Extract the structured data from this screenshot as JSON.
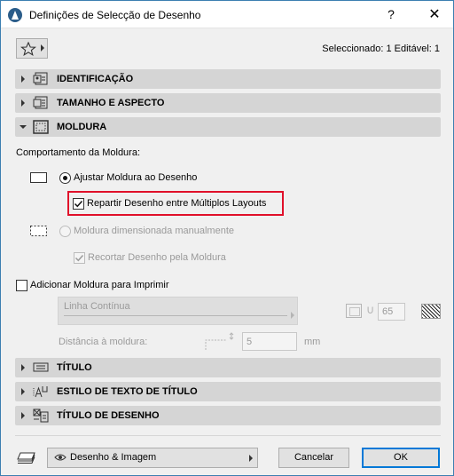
{
  "window": {
    "title": "Definições de Selecção de Desenho",
    "help_label": "?",
    "close_label": "✕"
  },
  "toolbar": {
    "favorites_icon": "star-icon",
    "selection_info": "Seleccionado: 1 Editável: 1"
  },
  "sections": [
    {
      "label": "IDENTIFICAÇÃO",
      "expanded": false,
      "icon": "id-card-icon"
    },
    {
      "label": "TAMANHO E ASPECTO",
      "expanded": false,
      "icon": "size-aspect-icon"
    },
    {
      "label": "MOLDURA",
      "expanded": true,
      "icon": "frame-icon"
    },
    {
      "label": "TÍTULO",
      "expanded": false,
      "icon": "title-icon"
    },
    {
      "label": "ESTILO DE TEXTO DE TÍTULO",
      "expanded": false,
      "icon": "title-text-style-icon"
    },
    {
      "label": "TÍTULO DE DESENHO",
      "expanded": false,
      "icon": "drawing-title-icon"
    }
  ],
  "frame": {
    "behavior_label": "Comportamento da Moldura:",
    "fit_frame_label": "Ajustar Moldura ao Desenho",
    "fit_frame_selected": true,
    "split_layouts_label": "Repartir Desenho entre Múltiplos Layouts",
    "split_layouts_checked": true,
    "manual_frame_label": "Moldura dimensionada manualmente",
    "manual_frame_selected": false,
    "crop_label": "Recortar Desenho pela Moldura",
    "crop_checked": true,
    "print_frame_label": "Adicionar Moldura para Imprimir",
    "print_frame_checked": false,
    "line_type_value": "Linha Contínua",
    "pen_value": "65",
    "distance_label": "Distância à moldura:",
    "distance_value": "5",
    "distance_unit": "mm"
  },
  "footer": {
    "view_label": "Desenho & Imagem",
    "cancel_label": "Cancelar",
    "ok_label": "OK"
  },
  "colors": {
    "accent": "#0078d7",
    "highlight_box": "#e0102a",
    "section_bg": "#d5d5d5"
  }
}
